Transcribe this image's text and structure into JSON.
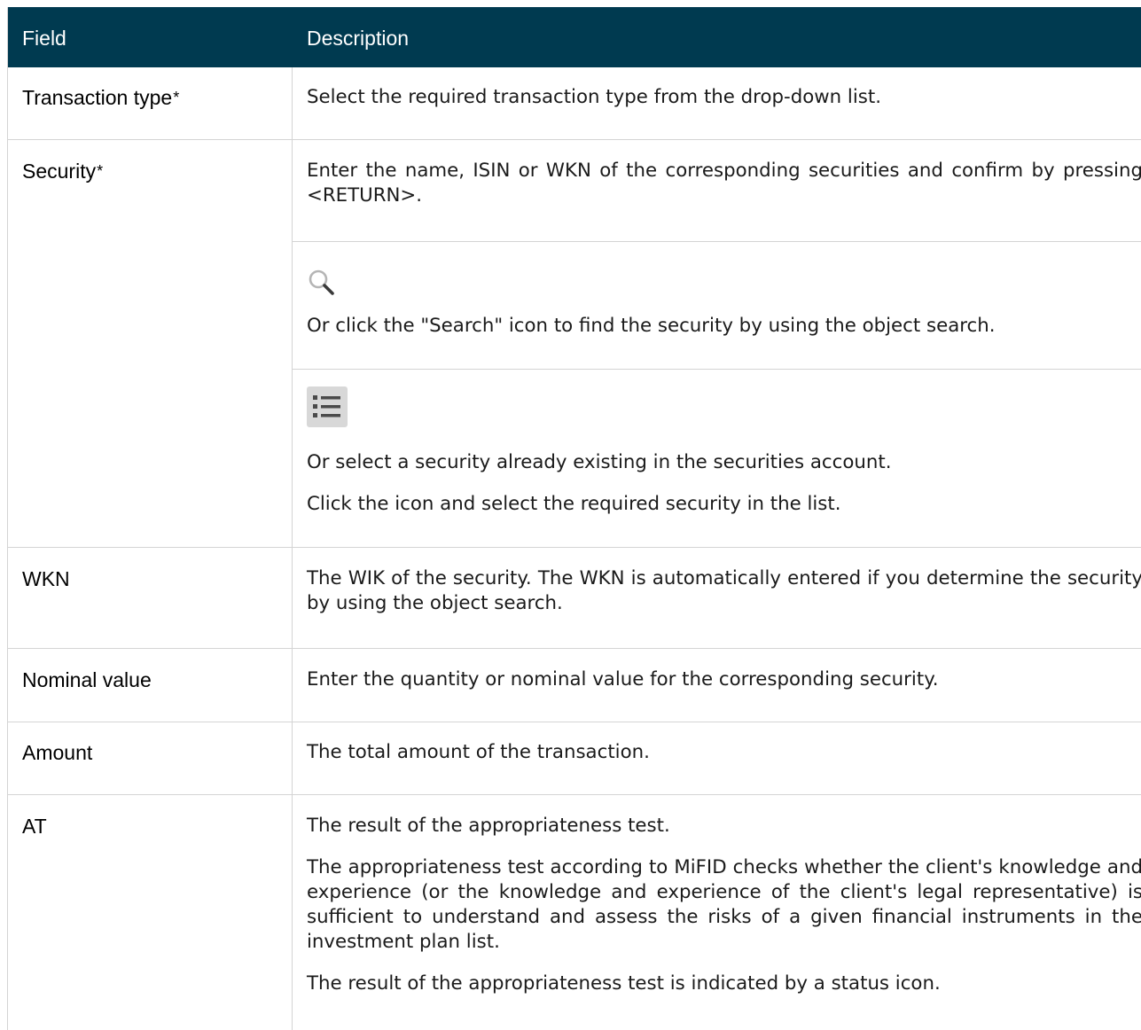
{
  "header": {
    "field": "Field",
    "description": "Description"
  },
  "required_marker": "*",
  "rows": [
    {
      "field": "Transaction type",
      "required": true,
      "description": [
        "Select the required transaction type from the drop-down list."
      ]
    },
    {
      "field": "Security",
      "required": true,
      "description": [
        "Enter the name, ISIN or WKN of the corresponding securities and confirm by pressing <RETURN>."
      ],
      "sub_rows": [
        {
          "icon": "search-icon",
          "description": [
            "Or click the \"Search\" icon to find the security by using the object search."
          ]
        },
        {
          "icon": "list-icon",
          "description": [
            "Or select a security already existing in the securities account.",
            "Click the icon and select the required security in the list."
          ]
        }
      ]
    },
    {
      "field": "WKN",
      "required": false,
      "description": [
        "The WIK of the security. The WKN is automatically entered if you determine the security by using the object search."
      ]
    },
    {
      "field": "Nominal value",
      "required": false,
      "description": [
        "Enter the quantity or nominal value for the corresponding security."
      ]
    },
    {
      "field": "Amount",
      "required": false,
      "description": [
        "The total amount of the transaction."
      ]
    },
    {
      "field": "AT",
      "required": false,
      "description": [
        "The result of the appropriateness test.",
        "The appropriateness test according to MiFID checks whether the client's knowledge and experience (or the knowledge and experience of the client's legal representative) is sufficient to understand and assess the risks of a given financial instruments in the investment plan list.",
        "The result of the appropriateness test is indicated by a status icon."
      ]
    }
  ],
  "colors": {
    "header_bg": "#003a50",
    "header_text": "#ffffff",
    "border": "#d4d4d4"
  }
}
